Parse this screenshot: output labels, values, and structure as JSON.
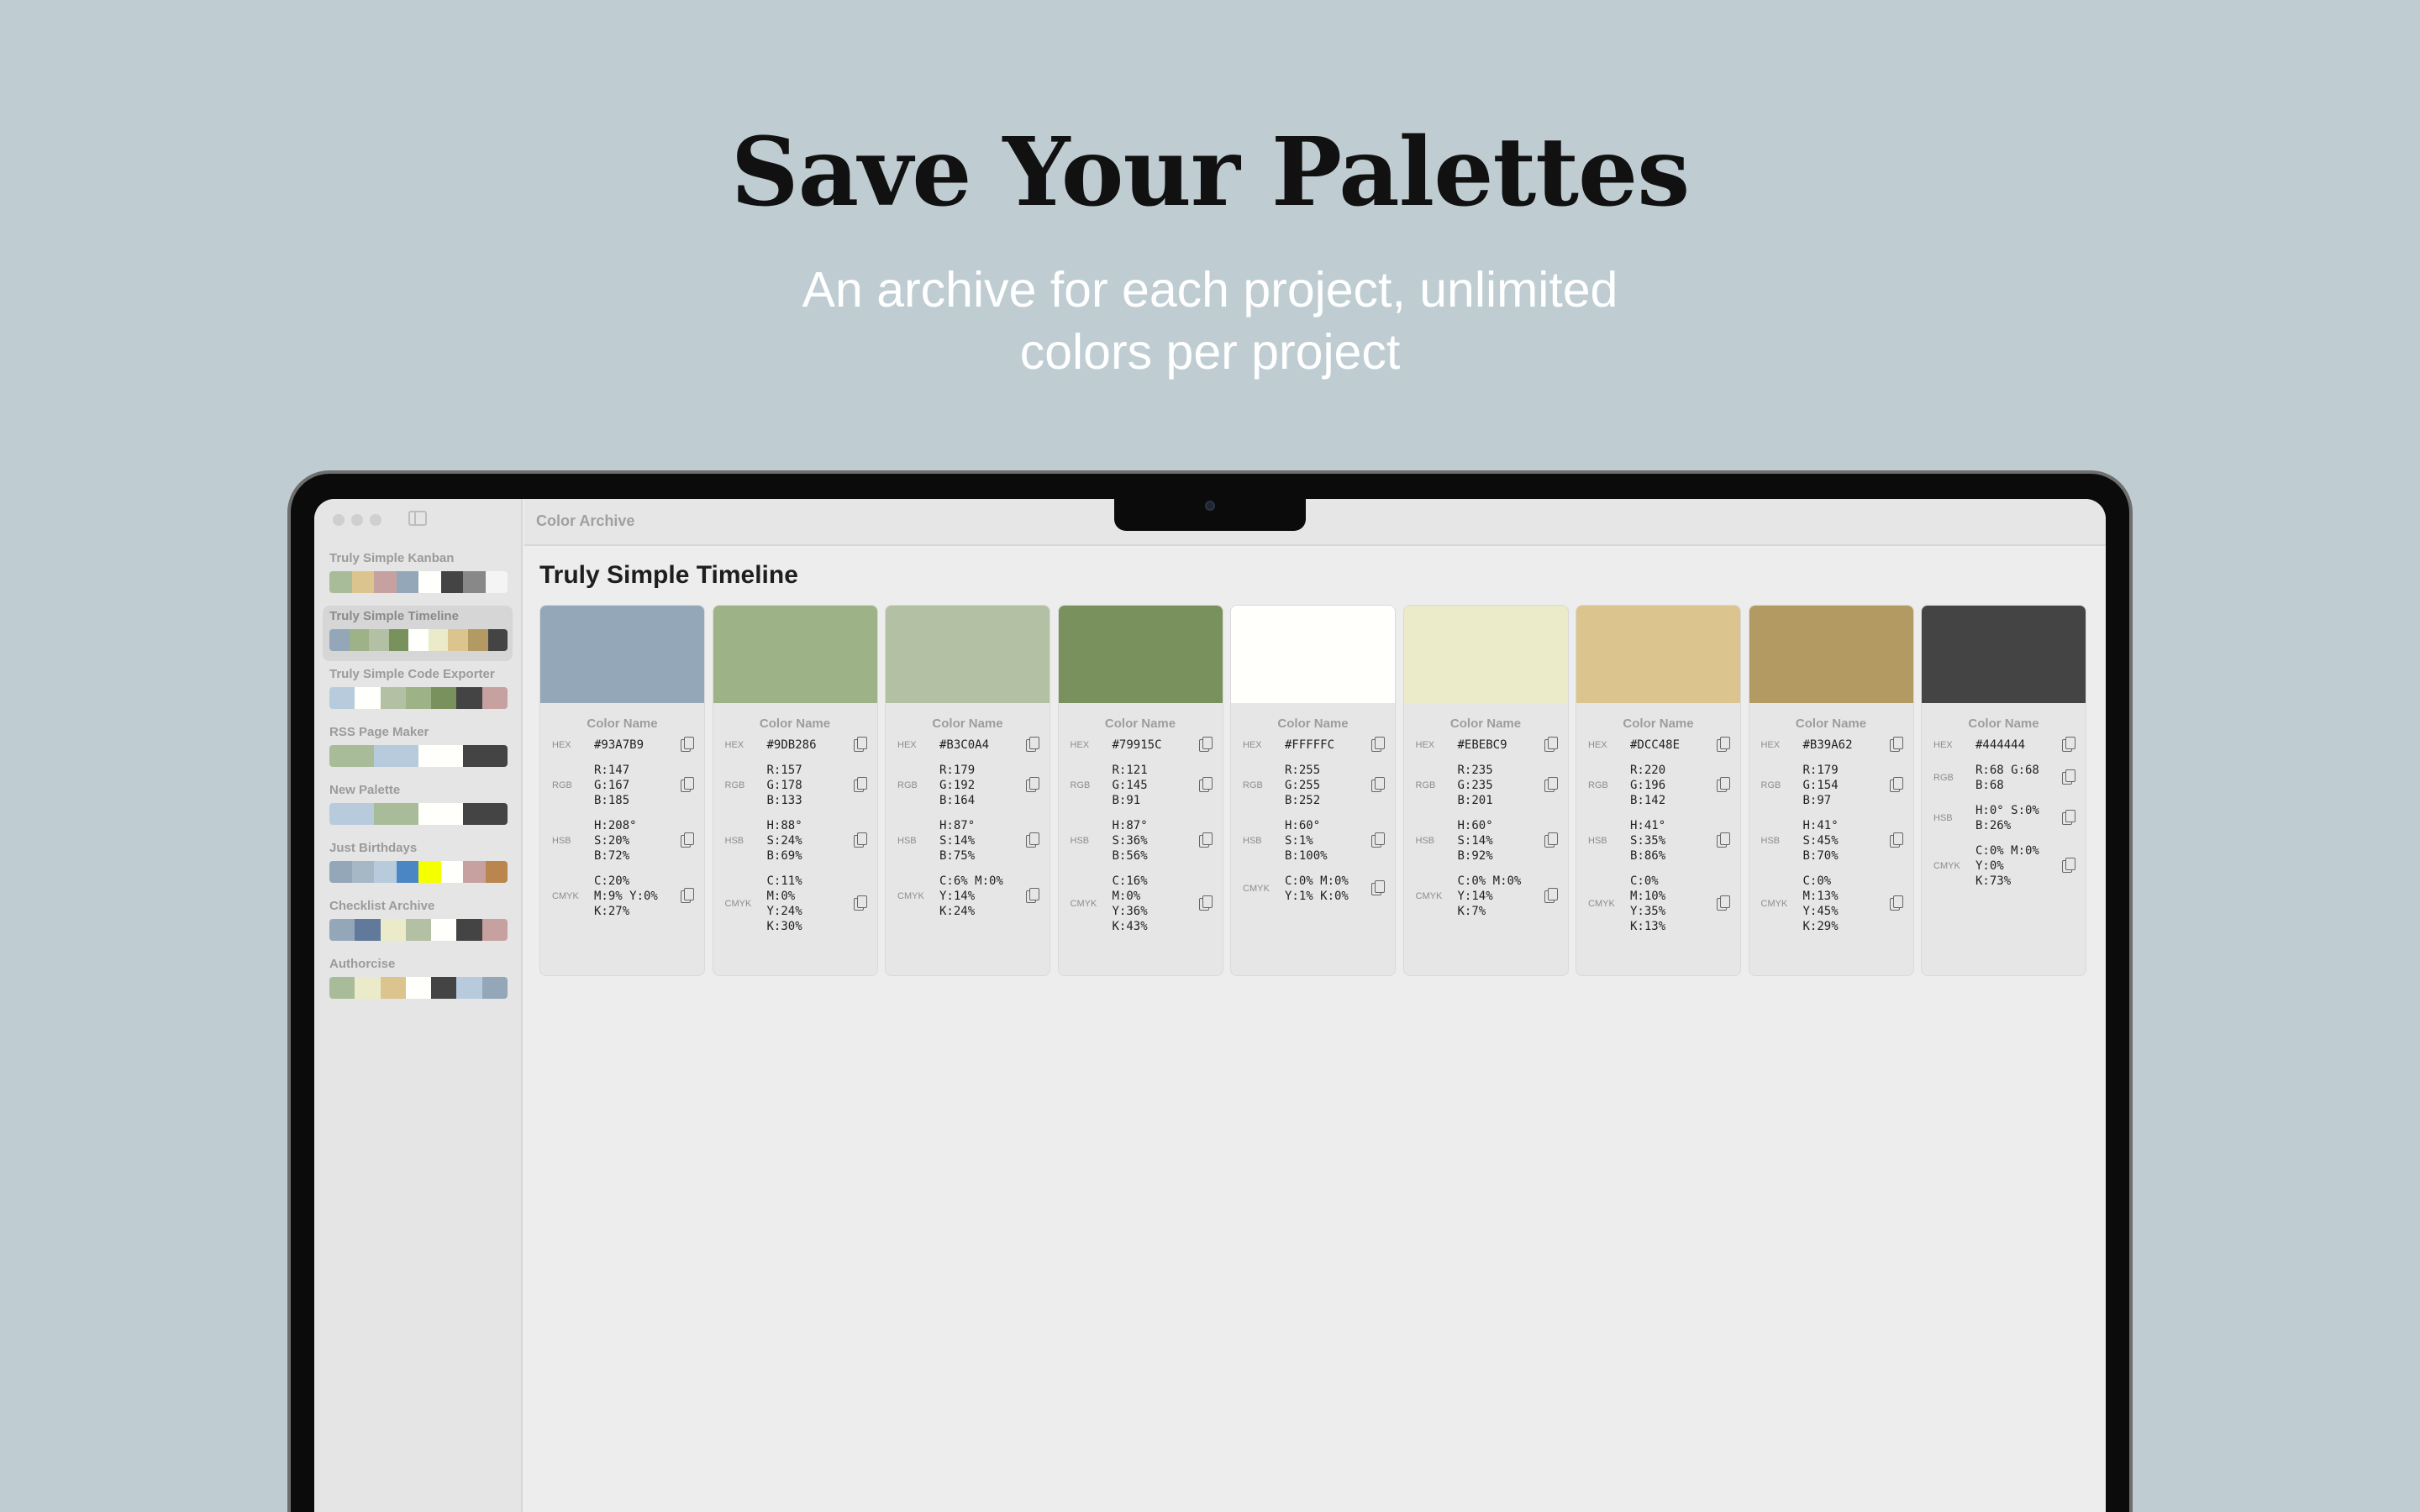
{
  "hero": {
    "headline": "Save Your Palettes",
    "subhead": "An archive for each project, unlimited colors per project"
  },
  "window": {
    "app_title": "Color Archive"
  },
  "sidebar": {
    "palettes": [
      {
        "name": "Truly Simple Kanban",
        "colors": [
          "#A9BC9A",
          "#DCC48E",
          "#C7A0A0",
          "#93A7B9",
          "#FFFFFC",
          "#444444",
          "#888888",
          "#F4F4F4"
        ]
      },
      {
        "name": "Truly Simple Timeline",
        "selected": true,
        "colors": [
          "#93A7B9",
          "#9DB286",
          "#B3C0A4",
          "#79915C",
          "#FFFFFC",
          "#EBEBC9",
          "#DCC48E",
          "#B39A62",
          "#444444"
        ]
      },
      {
        "name": "Truly Simple Code Exporter",
        "colors": [
          "#B8CBDD",
          "#FFFFFC",
          "#B3C0A4",
          "#9DB286",
          "#79915C",
          "#444444",
          "#C7A0A0"
        ]
      },
      {
        "name": "RSS Page Maker",
        "colors": [
          "#A9BC9A",
          "#B8CBDD",
          "#FFFFFC",
          "#444444"
        ]
      },
      {
        "name": "New Palette",
        "colors": [
          "#B8CBDD",
          "#A9BC9A",
          "#FFFFFC",
          "#444444"
        ]
      },
      {
        "name": "Just Birthdays",
        "colors": [
          "#93A7B9",
          "#A6B7C6",
          "#B8CBDD",
          "#4B86C4",
          "#F6FF00",
          "#FFFFFC",
          "#C7A0A0",
          "#B8864E"
        ]
      },
      {
        "name": "Checklist Archive",
        "colors": [
          "#93A7B9",
          "#61799A",
          "#EBEBC9",
          "#B3C0A4",
          "#FFFFFC",
          "#444444",
          "#C7A0A0"
        ]
      },
      {
        "name": "Authorcise",
        "colors": [
          "#A9BC9A",
          "#EBEBC9",
          "#DCC48E",
          "#FFFFFC",
          "#444444",
          "#B8CBDD",
          "#93A7B9"
        ]
      }
    ]
  },
  "main": {
    "title": "Truly Simple Timeline",
    "labels": {
      "hex": "HEX",
      "rgb": "RGB",
      "hsb": "HSB",
      "cmyk": "CMYK",
      "color_name": "Color Name"
    },
    "colors": [
      {
        "swatch": "#93A7B9",
        "name": "Color Name",
        "hex": "#93A7B9",
        "rgb": "R:147\nG:167\nB:185",
        "hsb": "H:208°\nS:20%\nB:72%",
        "cmyk": "C:20%\nM:9% Y:0%\nK:27%"
      },
      {
        "swatch": "#9DB286",
        "name": "Color Name",
        "hex": "#9DB286",
        "rgb": "R:157\nG:178\nB:133",
        "hsb": "H:88°\nS:24%\nB:69%",
        "cmyk": "C:11%\nM:0%\nY:24%\nK:30%"
      },
      {
        "swatch": "#B3C0A4",
        "name": "Color Name",
        "hex": "#B3C0A4",
        "rgb": "R:179\nG:192\nB:164",
        "hsb": "H:87°\nS:14%\nB:75%",
        "cmyk": "C:6% M:0%\nY:14%\nK:24%"
      },
      {
        "swatch": "#79915C",
        "name": "Color Name",
        "hex": "#79915C",
        "rgb": "R:121\nG:145\nB:91",
        "hsb": "H:87°\nS:36%\nB:56%",
        "cmyk": "C:16%\nM:0%\nY:36%\nK:43%"
      },
      {
        "swatch": "#FFFFFC",
        "name": "Color Name",
        "hex": "#FFFFFC",
        "rgb": "R:255\nG:255\nB:252",
        "hsb": "H:60°\nS:1%\nB:100%",
        "cmyk": "C:0% M:0%\nY:1% K:0%"
      },
      {
        "swatch": "#EBEBC9",
        "name": "Color Name",
        "hex": "#EBEBC9",
        "rgb": "R:235\nG:235\nB:201",
        "hsb": "H:60°\nS:14%\nB:92%",
        "cmyk": "C:0% M:0%\nY:14%\nK:7%"
      },
      {
        "swatch": "#DCC48E",
        "name": "Color Name",
        "hex": "#DCC48E",
        "rgb": "R:220\nG:196\nB:142",
        "hsb": "H:41°\nS:35%\nB:86%",
        "cmyk": "C:0%\nM:10%\nY:35%\nK:13%"
      },
      {
        "swatch": "#B39A62",
        "name": "Color Name",
        "hex": "#B39A62",
        "rgb": "R:179\nG:154\nB:97",
        "hsb": "H:41°\nS:45%\nB:70%",
        "cmyk": "C:0%\nM:13%\nY:45%\nK:29%"
      },
      {
        "swatch": "#444444",
        "name": "Color Name",
        "hex": "#444444",
        "rgb": "R:68 G:68\nB:68",
        "hsb": "H:0° S:0%\nB:26%",
        "cmyk": "C:0% M:0%\nY:0%\nK:73%"
      }
    ]
  },
  "icons": {
    "copy": "copy-icon",
    "sidebar_toggle": "sidebar-toggle-icon"
  }
}
